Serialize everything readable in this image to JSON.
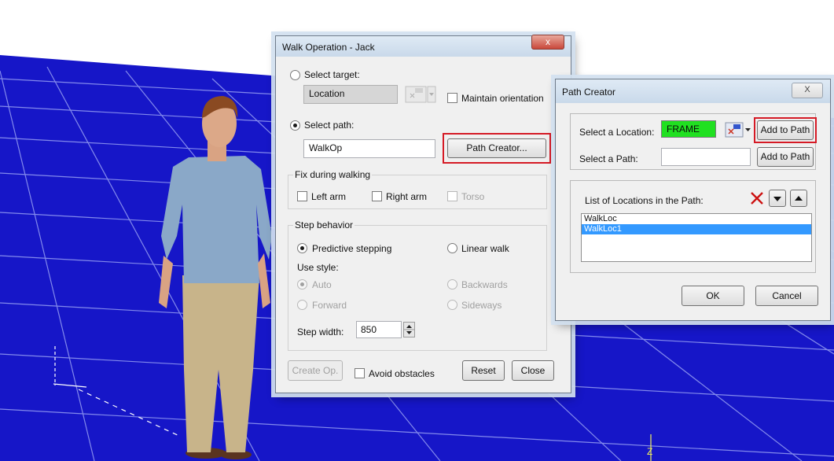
{
  "colors": {
    "sky": "#ffffff",
    "floor": "#1616c8",
    "grid_line": "#8f97f0",
    "highlight": "#d51a25",
    "frame_field": "#21e021",
    "list_selection": "#3399ff"
  },
  "scene": {
    "axis_label": "Z"
  },
  "walk_dialog": {
    "title": "Walk Operation - Jack",
    "close_glyph": "x",
    "select_target_label": "Select target:",
    "target_value": "Location",
    "maintain_orientation_label": "Maintain orientation",
    "select_path_label": "Select path:",
    "path_value": "WalkOp",
    "path_creator_button": "Path Creator...",
    "fix_group": {
      "title": "Fix during walking",
      "left_arm": "Left arm",
      "right_arm": "Right arm",
      "torso": "Torso"
    },
    "step_group": {
      "title": "Step behavior",
      "predictive": "Predictive stepping",
      "linear": "Linear walk",
      "use_style": "Use style:",
      "auto": "Auto",
      "backwards": "Backwards",
      "forward": "Forward",
      "sideways": "Sideways",
      "step_width_label": "Step width:",
      "step_width_value": "850"
    },
    "create_op_button": "Create Op.",
    "avoid_obstacles_label": "Avoid obstacles",
    "reset_button": "Reset",
    "close_button": "Close"
  },
  "path_dialog": {
    "title": "Path Creator",
    "close_glyph": "X",
    "select_location_label": "Select a Location:",
    "location_value": "FRAME",
    "add_location_button": "Add to Path",
    "select_path_label": "Select a Path:",
    "path_value": "",
    "add_path_button": "Add to Path",
    "list_label": "List of Locations in the Path:",
    "list_items": [
      "WalkLoc",
      "WalkLoc1"
    ],
    "selected_index": 1,
    "ok_button": "OK",
    "cancel_button": "Cancel"
  }
}
